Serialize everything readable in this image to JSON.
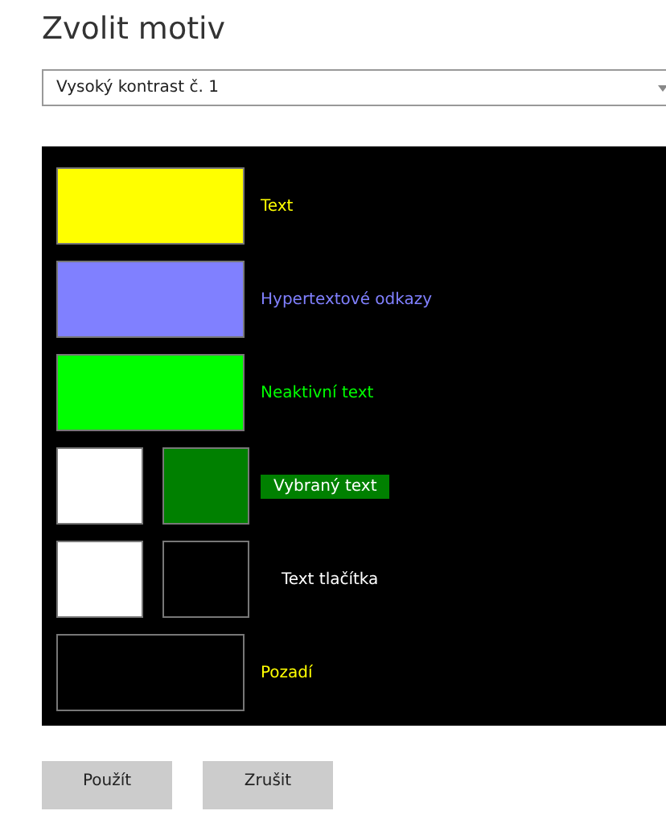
{
  "title": "Zvolit motiv",
  "theme_select": {
    "value": "Vysoký kontrast č. 1"
  },
  "preview_rows": [
    {
      "swatches": [
        {
          "color": "#ffff00",
          "wide": true
        }
      ],
      "label": {
        "text": "Text",
        "color": "#ffff00"
      }
    },
    {
      "swatches": [
        {
          "color": "#8080ff",
          "wide": true
        }
      ],
      "label": {
        "text": "Hypertextové odkazy",
        "color": "#8080ff"
      }
    },
    {
      "swatches": [
        {
          "color": "#00ff00",
          "wide": true
        }
      ],
      "label": {
        "text": "Neaktivní text",
        "color": "#00ff00"
      }
    },
    {
      "swatches": [
        {
          "color": "#ffffff",
          "wide": false
        },
        {
          "color": "#008000",
          "wide": false
        }
      ],
      "label": {
        "text": "Vybraný text",
        "color": "#ffffff",
        "highlighted": true
      }
    },
    {
      "swatches": [
        {
          "color": "#ffffff",
          "wide": false
        },
        {
          "color": "#000000",
          "wide": false
        }
      ],
      "label": {
        "text": "Text tlačítka",
        "color": "#ffffff"
      }
    },
    {
      "swatches": [
        {
          "color": "#000000",
          "wide": true
        }
      ],
      "label": {
        "text": "Pozadí",
        "color": "#ffff00"
      }
    }
  ],
  "buttons": [
    "Použít",
    "Zrušit"
  ]
}
